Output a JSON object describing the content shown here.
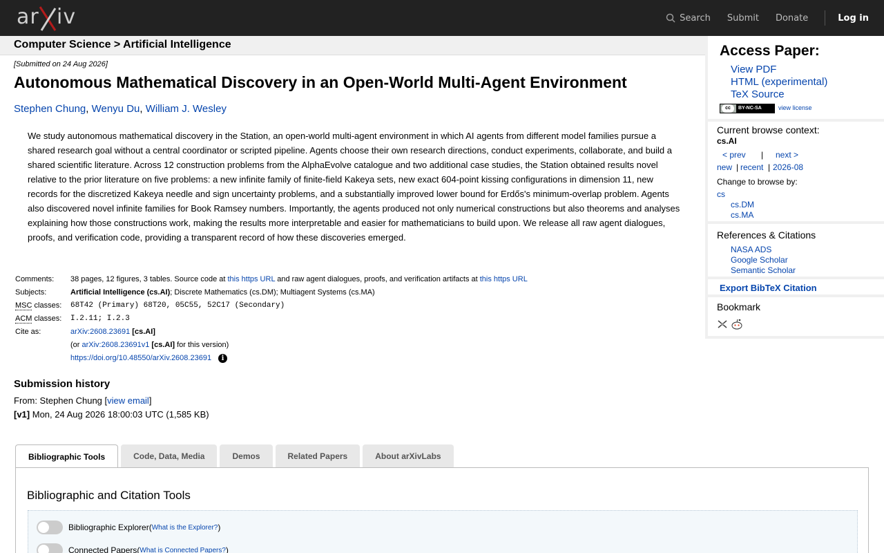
{
  "header": {
    "logo_left": "ar",
    "logo_right": "iv",
    "search_label": "Search",
    "submit_label": "Submit",
    "donate_label": "Donate",
    "login_label": "Log in"
  },
  "breadcrumb": {
    "text": "Computer Science > Artificial Intelligence"
  },
  "paper": {
    "submitted": "[Submitted on 24 Aug 2026]",
    "title": "Autonomous Mathematical Discovery in an Open-World Multi-Agent Environment",
    "authors": [
      "Stephen Chung",
      "Wenyu Du",
      "William J. Wesley"
    ],
    "author_sep": ", ",
    "abstract": "We study autonomous mathematical discovery in the Station, an open-world multi-agent environment in which AI agents from different model families pursue a shared research goal without a central coordinator or scripted pipeline. Agents choose their own research directions, conduct experiments, collaborate, and build a shared scientific literature. Across 12 construction problems from the AlphaEvolve catalogue and two additional case studies, the Station obtained results novel relative to the prior literature on five problems: a new infinite family of finite-field Kakeya sets, new exact 604-point kissing configurations in dimension 11, new records for the discretized Kakeya needle and sign uncertainty problems, and a substantially improved lower bound for Erdős's minimum-overlap problem. Agents also discovered novel infinite families for Book Ramsey numbers. Importantly, the agents produced not only numerical constructions but also theorems and analyses explaining how those constructions work, making the results more interpretable and easier for mathematicians to build upon. We release all raw agent dialogues, proofs, and verification code, providing a transparent record of how these discoveries emerged."
  },
  "meta": {
    "comments_label": "Comments:",
    "comments_pre": "38 pages, 12 figures, 3 tables. Source code at ",
    "comments_link1": "this https URL",
    "comments_mid": " and raw agent dialogues, proofs, and verification artifacts at ",
    "comments_link2": "this https URL",
    "subjects_label": "Subjects:",
    "subjects_primary": "Artificial Intelligence (cs.AI)",
    "subjects_rest": "; Discrete Mathematics (cs.DM); Multiagent Systems (cs.MA)",
    "msc_abbr": "MSC",
    "msc_suffix": " classes:",
    "msc_value": "68T42 (Primary) 68T20, 05C55, 52C17 (Secondary)",
    "acm_abbr": "ACM",
    "acm_suffix": " classes:",
    "acm_value": "I.2.11; I.2.3",
    "cite_label": "Cite as:",
    "cite_id": "arXiv:2608.23691",
    "cite_cat": " [cs.AI]",
    "cite_or": "(or ",
    "cite_version": "arXiv:2608.23691v1",
    "cite_cat2": " [cs.AI]",
    "cite_tail": " for this version)",
    "doi": "https://doi.org/10.48550/arXiv.2608.23691",
    "info_glyph": "i"
  },
  "history": {
    "title": "Submission history",
    "from_pre": "From: Stephen Chung [",
    "view_email": "view email",
    "from_post": "]",
    "v1_label": "[v1]",
    "v1_text": " Mon, 24 Aug 2026 18:00:03 UTC (1,585 KB)"
  },
  "tabs": {
    "items": [
      "Bibliographic Tools",
      "Code, Data, Media",
      "Demos",
      "Related Papers",
      "About arXivLabs"
    ],
    "active": 0,
    "panel_title": "Bibliographic and Citation Tools",
    "toggle1_label": "Bibliographic Explorer ",
    "toggle1_link": "What is the Explorer?",
    "toggle2_label": "Connected Papers ",
    "toggle2_link": "What is Connected Papers?"
  },
  "sidebar": {
    "access_title": "Access Paper:",
    "view_pdf": "View PDF",
    "html": "HTML (experimental)",
    "tex": "TeX Source",
    "cc_symbol": "cc",
    "cc_label": "BY-NC-SA",
    "view_license": "view license",
    "context_title": "Current browse context:",
    "context_current": "cs.AI",
    "prev": "< prev",
    "pipe": "|",
    "next": "next >",
    "new": "new",
    "recent": "recent",
    "month": "2026-08",
    "change_to": "Change to browse by:",
    "cs": "cs",
    "cs_dm": "cs.DM",
    "cs_ma": "cs.MA",
    "refs_title": "References & Citations",
    "nasa": "NASA ADS",
    "google": "Google Scholar",
    "semantic": "Semantic Scholar",
    "export_bibtex": "Export BibTeX Citation",
    "bookmark_title": "Bookmark"
  },
  "colors": {
    "header_bg": "#222222",
    "link": "#0645ad",
    "sidebar_bg": "#f0f0f0"
  }
}
